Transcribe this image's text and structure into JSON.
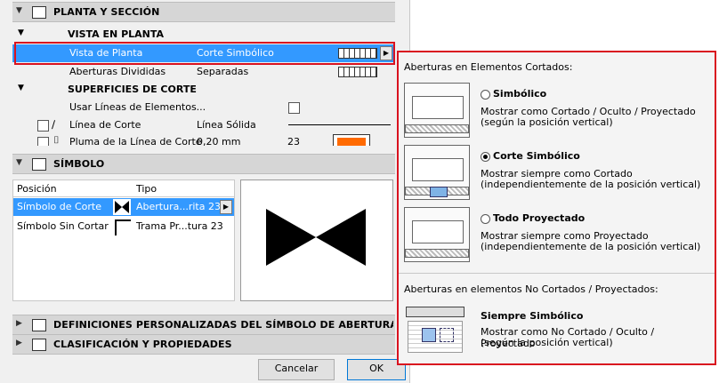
{
  "sections": {
    "plan_section": {
      "label": "PLANTA Y SECCIÓN"
    },
    "symbol": {
      "label": "SÍMBOLO"
    },
    "custom_defs": {
      "label": "DEFINICIONES PERSONALIZADAS DEL SÍMBOLO DE ABERTURA (SÍMBOLO"
    },
    "classification": {
      "label": "CLASIFICACIÓN Y PROPIEDADES"
    }
  },
  "plan_view": {
    "heading": "VISTA EN PLANTA",
    "rows": [
      {
        "key": "Vista de Planta",
        "value": "Corte Simbólico"
      },
      {
        "key": "Aberturas Divididas",
        "value": "Separadas"
      }
    ]
  },
  "cut_surfaces": {
    "heading": "SUPERFICIES DE CORTE",
    "rows": [
      {
        "key": "Usar Líneas de Elementos...",
        "value": ""
      },
      {
        "key": "Línea de Corte",
        "value": "Línea Sólida"
      },
      {
        "key": "Pluma de la Línea de Corte",
        "value": "0,20 mm",
        "extra": "23"
      }
    ]
  },
  "symbol_table": {
    "headers": [
      "Posición",
      "Tipo"
    ],
    "rows": [
      {
        "position": "Símbolo de Corte",
        "type": "Abertura...rita 23"
      },
      {
        "position": "Símbolo Sin Cortar",
        "type": "Trama Pr...tura 23"
      }
    ]
  },
  "buttons": {
    "cancel": "Cancelar",
    "ok": "OK"
  },
  "popup": {
    "cut_title": "Aberturas en Elementos Cortados:",
    "options": [
      {
        "title": "Simbólico",
        "desc1": "Mostrar como Cortado / Oculto / Proyectado",
        "desc2": "(según la posición vertical)",
        "selected": false
      },
      {
        "title": "Corte Simbólico",
        "desc1": "Mostrar siempre como Cortado",
        "desc2": "(independientemente de la posición vertical)",
        "selected": true
      },
      {
        "title": "Todo Proyectado",
        "desc1": "Mostrar siempre como Proyectado",
        "desc2": "(independientemente de la posición vertical)",
        "selected": false
      }
    ],
    "uncut_title": "Aberturas en elementos No Cortados / Proyectados:",
    "uncut_option": {
      "title": "Siempre Simbólico",
      "desc1": "Mostrar como No Cortado / Oculto / Proyectado",
      "desc2": "(según la posición vertical)"
    }
  },
  "colors": {
    "selection": "#3399ff",
    "highlight_border": "#d9121f",
    "pen_swatch": "#ff6a00"
  }
}
